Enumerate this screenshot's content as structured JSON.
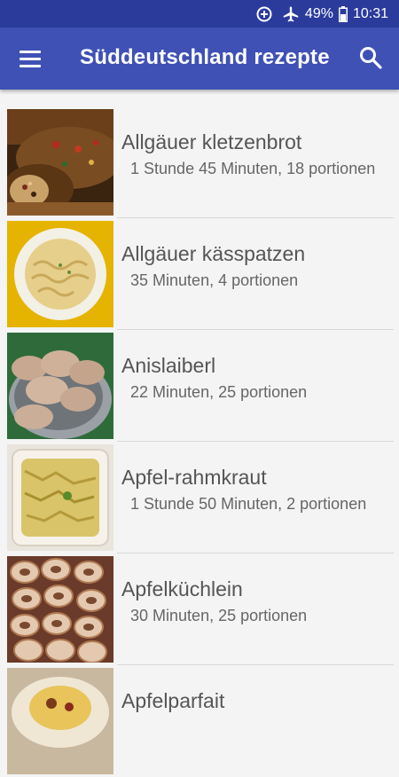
{
  "status_bar": {
    "battery": "49%",
    "time": "10:31",
    "icons": [
      "data-saver-icon",
      "airplane-mode-icon",
      "battery-icon"
    ]
  },
  "app_bar": {
    "title": "Süddeutschland rezepte",
    "menu_icon": "hamburger-menu-icon",
    "search_icon": "search-icon"
  },
  "recipes": [
    {
      "name": "Allgäuer kletzenbrot",
      "meta": "  1 Stunde 45 Minuten, 18 portionen",
      "image": "fruit-bread-photo"
    },
    {
      "name": "Allgäuer kässpatzen",
      "meta": "  35 Minuten, 4 portionen",
      "image": "cheese-spaetzle-photo"
    },
    {
      "name": "Anislaiberl",
      "meta": "  22 Minuten, 25 portionen",
      "image": "anise-cookies-photo"
    },
    {
      "name": "Apfel-rahmkraut",
      "meta": "  1 Stunde 50 Minuten, 2 portionen",
      "image": "apple-cream-cabbage-photo"
    },
    {
      "name": "Apfelküchlein",
      "meta": "  30 Minuten, 25 portionen",
      "image": "apple-fritters-photo"
    },
    {
      "name": "Apfelparfait",
      "meta": "",
      "image": "apple-parfait-photo"
    }
  ]
}
